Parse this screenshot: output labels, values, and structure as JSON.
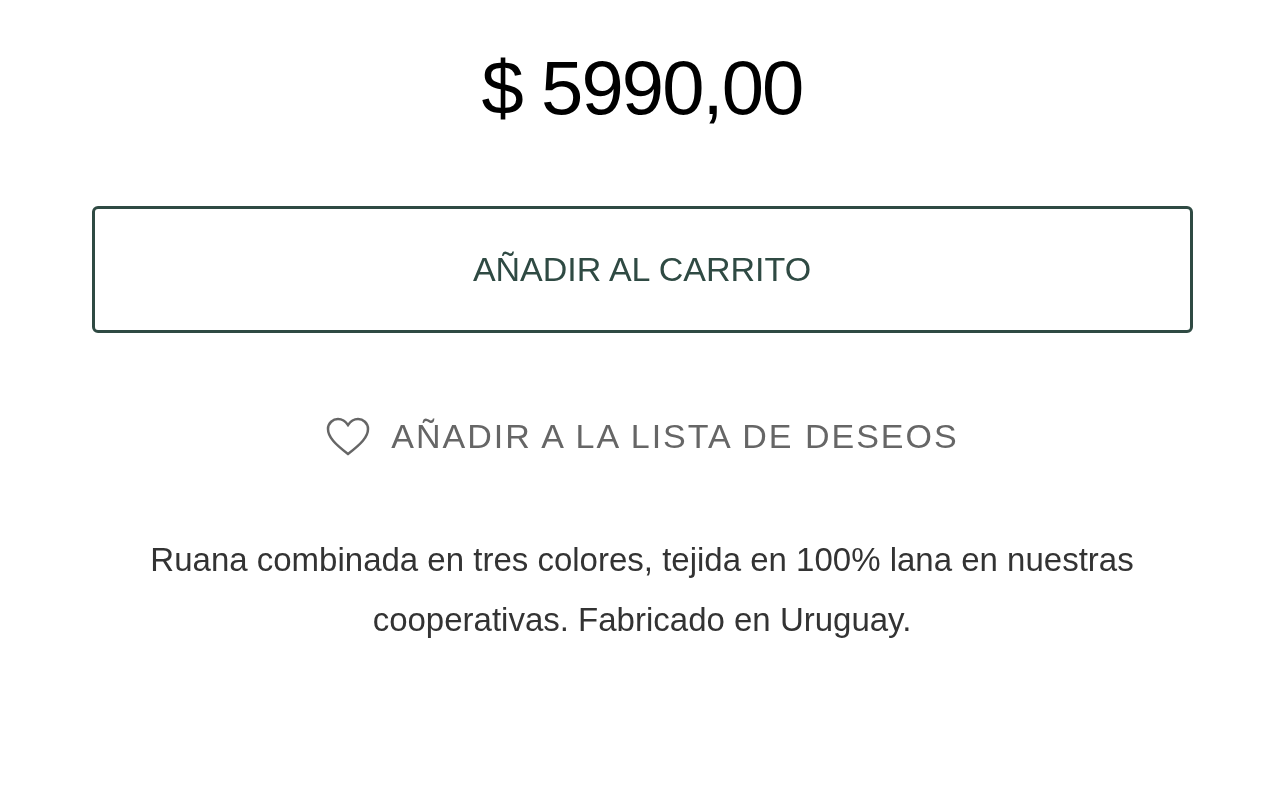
{
  "price": "$ 5990,00",
  "add_to_cart": {
    "label": "AÑADIR AL CARRITO"
  },
  "wishlist": {
    "label": "AÑADIR A LA LISTA DE DESEOS"
  },
  "description": "Ruana combinada en tres colores, tejida en 100% lana en nuestras cooperativas. Fabricado en Uruguay."
}
